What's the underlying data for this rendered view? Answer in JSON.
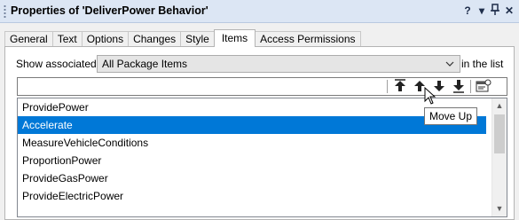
{
  "window": {
    "title": "Properties of 'DeliverPower Behavior'",
    "controls": [
      "?",
      "▾",
      "📌",
      "✕"
    ]
  },
  "tabs": [
    {
      "label": "General",
      "active": false
    },
    {
      "label": "Text",
      "active": false
    },
    {
      "label": "Options",
      "active": false
    },
    {
      "label": "Changes",
      "active": false
    },
    {
      "label": "Style",
      "active": false
    },
    {
      "label": "Items",
      "active": true
    },
    {
      "label": "Access Permissions",
      "active": false
    }
  ],
  "filter": {
    "label": "Show associated",
    "selected": "All Package Items",
    "suffix": "in the list"
  },
  "toolbar": {
    "buttons": [
      "move-to-top-icon",
      "move-up-icon",
      "move-down-icon",
      "move-to-bottom-icon",
      "properties-icon"
    ]
  },
  "items": [
    {
      "label": "ProvidePower",
      "selected": false
    },
    {
      "label": "Accelerate",
      "selected": true
    },
    {
      "label": "MeasureVehicleConditions",
      "selected": false
    },
    {
      "label": "ProportionPower",
      "selected": false
    },
    {
      "label": "ProvideGasPower",
      "selected": false
    },
    {
      "label": "ProvideElectricPower",
      "selected": false
    }
  ],
  "tooltip": "Move Up"
}
